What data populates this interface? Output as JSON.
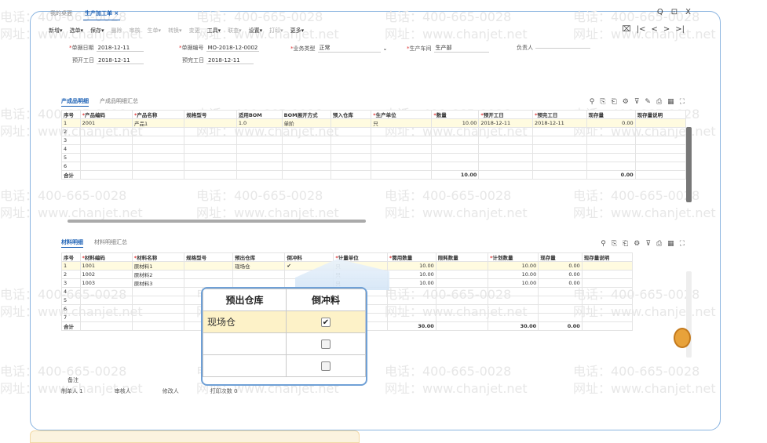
{
  "watermark": {
    "phone": "电话：400-665-0028",
    "site": "网址：www.chanjet.net"
  },
  "tabs": [
    {
      "label": "我的桌面"
    },
    {
      "label": "生产加工单 ×"
    }
  ],
  "window_controls": {
    "search": "Q",
    "restore": "⊡",
    "close": "X"
  },
  "toolbar": [
    "新增▾",
    "选单▾",
    "保存▾",
    "删除",
    "审核",
    "生单▾",
    "转换▾",
    "变更",
    "工具▾",
    "联查▾",
    "设置▾",
    "打印▾",
    "更多▾"
  ],
  "nav_controls": {
    "export": "⌧",
    "first": "|<",
    "prev": "<",
    "next": ">",
    "last": ">|"
  },
  "form": {
    "doc_date_label": "单据日期",
    "doc_date": "2018-12-11",
    "doc_no_label": "单据编号",
    "doc_no": "MO-2018-12-0002",
    "biz_type_label": "业务类型",
    "biz_type": "正常",
    "workshop_label": "生产车间",
    "workshop": "生产部",
    "owner_label": "负责人",
    "owner": "",
    "plan_start_label": "预开工日",
    "plan_start": "2018-12-11",
    "plan_end_label": "预完工日",
    "plan_end": "2018-12-11"
  },
  "product_section": {
    "tabs": [
      "产成品明细",
      "产成品明细汇总"
    ],
    "columns": [
      "序号",
      "产品编码",
      "产品名称",
      "规格型号",
      "适用BOM",
      "BOM展开方式",
      "预入仓库",
      "生产单位",
      "数量",
      "预开工日",
      "预完工日",
      "现存量",
      "现存量说明"
    ],
    "rows": [
      [
        "1",
        "2001",
        "产品1",
        "",
        "1.0",
        "单阶",
        "",
        "只",
        "10.00",
        "2018-12-11",
        "2018-12-11",
        "0.00",
        ""
      ],
      [
        "2",
        "",
        "",
        "",
        "",
        "",
        "",
        "",
        "",
        "",
        "",
        "",
        ""
      ],
      [
        "3",
        "",
        "",
        "",
        "",
        "",
        "",
        "",
        "",
        "",
        "",
        "",
        ""
      ],
      [
        "4",
        "",
        "",
        "",
        "",
        "",
        "",
        "",
        "",
        "",
        "",
        "",
        ""
      ],
      [
        "5",
        "",
        "",
        "",
        "",
        "",
        "",
        "",
        "",
        "",
        "",
        "",
        ""
      ],
      [
        "6",
        "",
        "",
        "",
        "",
        "",
        "",
        "",
        "",
        "",
        "",
        "",
        ""
      ]
    ],
    "total_label": "合计",
    "total_qty": "10.00",
    "total_stock": "0.00"
  },
  "material_section": {
    "tabs": [
      "材料明细",
      "材料明细汇总"
    ],
    "columns": [
      "序号",
      "材料编码",
      "材料名称",
      "规格型号",
      "预出仓库",
      "倒冲料",
      "计量单位",
      "需用数量",
      "限耗数量",
      "计划数量",
      "现存量",
      "现存量说明"
    ],
    "rows": [
      [
        "1",
        "1001",
        "原材料1",
        "",
        "现场仓",
        "✔",
        "只",
        "10.00",
        "",
        "10.00",
        "0.00",
        ""
      ],
      [
        "2",
        "1002",
        "原材料2",
        "",
        "",
        "",
        "只",
        "10.00",
        "",
        "10.00",
        "0.00",
        ""
      ],
      [
        "3",
        "1003",
        "原材料3",
        "",
        "",
        "",
        "只",
        "10.00",
        "",
        "10.00",
        "0.00",
        ""
      ],
      [
        "4",
        "",
        "",
        "",
        "",
        "",
        "",
        "",
        "",
        "",
        "",
        ""
      ],
      [
        "5",
        "",
        "",
        "",
        "",
        "",
        "",
        "",
        "",
        "",
        "",
        ""
      ],
      [
        "6",
        "",
        "",
        "",
        "",
        "",
        "",
        "",
        "",
        "",
        "",
        ""
      ],
      [
        "7",
        "",
        "",
        "",
        "",
        "",
        "",
        "",
        "",
        "",
        "",
        ""
      ]
    ],
    "total_label": "合计",
    "total_need": "30.00",
    "total_plan": "30.00",
    "total_stock": "0.00"
  },
  "footer": {
    "remark_label": "备注",
    "creator_label": "制单人",
    "creator": "1",
    "reviewer_label": "审核人",
    "modifier_label": "修改人",
    "print_label": "打印次数",
    "print_count": "0"
  },
  "zoom": {
    "col1": "预出仓库",
    "col2": "倒冲料",
    "rows": [
      {
        "warehouse": "现场仓",
        "checked": true
      },
      {
        "warehouse": "",
        "checked": false
      },
      {
        "warehouse": "",
        "checked": false
      }
    ]
  }
}
